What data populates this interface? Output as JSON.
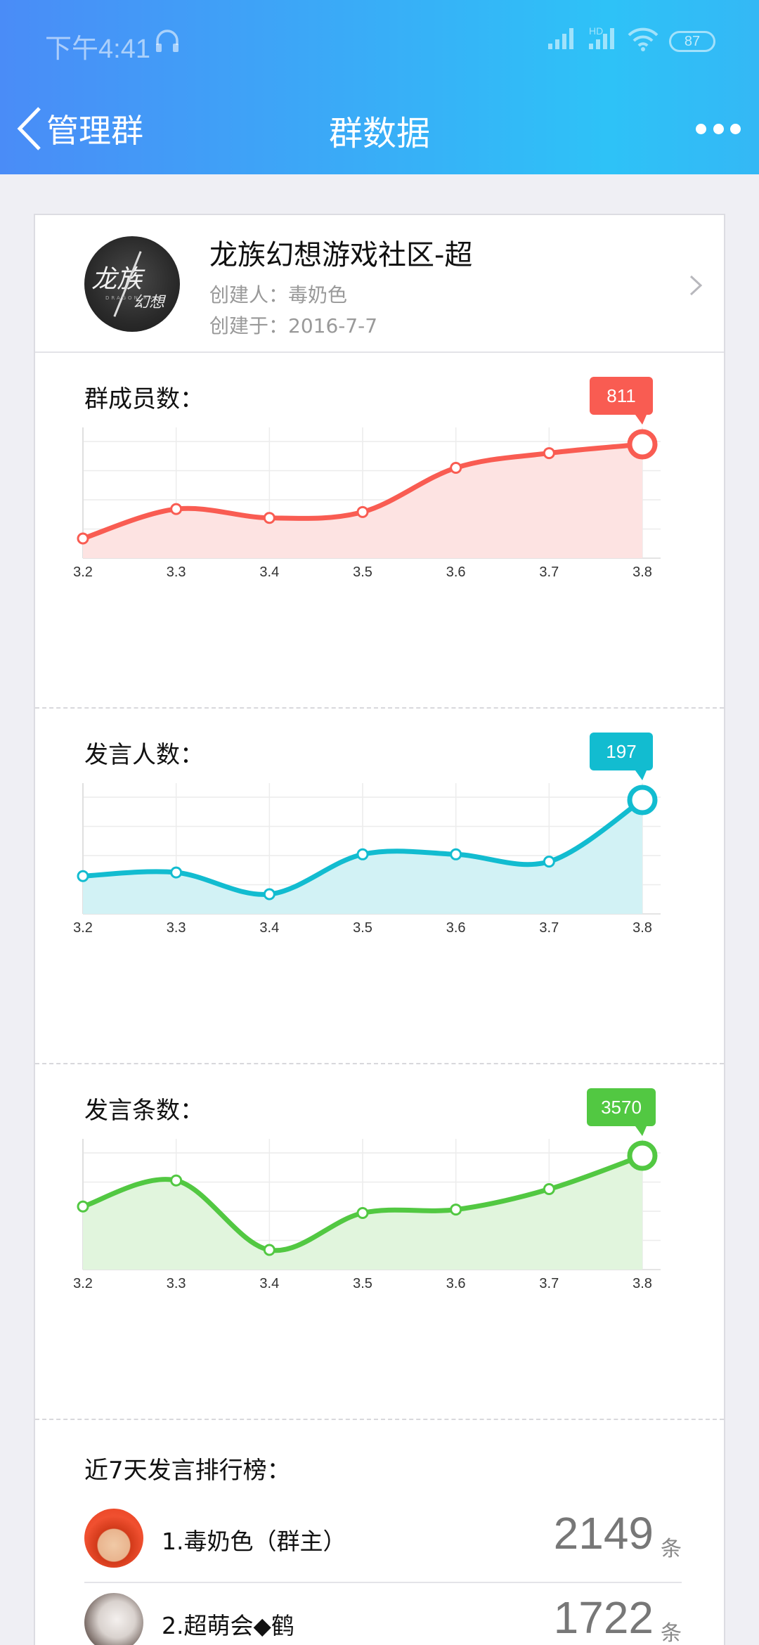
{
  "status_bar": {
    "time": "下午4:41",
    "network_badge": "HD",
    "battery": "87"
  },
  "nav": {
    "back_label": "管理群",
    "title": "群数据",
    "more_icon": "more-icon"
  },
  "group": {
    "name": "龙族幻想游戏社区-超",
    "creator": "创建人：毒奶色",
    "created": "创建于：2016-7-7",
    "avatar_text": "龙族",
    "avatar_text2": "幻想",
    "avatar_sub": "DRAGON RAJA"
  },
  "charts_meta": {
    "members_title": "群成员数：",
    "speakers_title": "发言人数：",
    "messages_title": "发言条数："
  },
  "chart_data": [
    {
      "type": "area",
      "categories": [
        "3.2",
        "3.3",
        "3.4",
        "3.5",
        "3.6",
        "3.7",
        "3.8"
      ],
      "series": [
        {
          "values": [
            795,
            800,
            798.5,
            799.5,
            807,
            809.5,
            811
          ]
        }
      ],
      "highlight_label": "811",
      "color": "#f95c52",
      "fill": "#fde3e2",
      "grid": true
    },
    {
      "type": "area",
      "categories": [
        "3.2",
        "3.3",
        "3.4",
        "3.5",
        "3.6",
        "3.7",
        "3.8"
      ],
      "series": [
        {
          "values": [
            176,
            177,
            171,
            182,
            182,
            180,
            197
          ]
        }
      ],
      "highlight_label": "197",
      "color": "#12bcd0",
      "fill": "#d2f2f5",
      "grid": true
    },
    {
      "type": "area",
      "categories": [
        "3.2",
        "3.3",
        "3.4",
        "3.5",
        "3.6",
        "3.7",
        "3.8"
      ],
      "series": [
        {
          "values": [
            2400,
            3000,
            1400,
            2250,
            2330,
            2800,
            3570
          ]
        }
      ],
      "highlight_label": "3570",
      "color": "#52c842",
      "fill": "#e1f5dd",
      "grid": true
    }
  ],
  "ranking": {
    "title": "近7天发言排行榜：",
    "unit": "条",
    "rows": [
      {
        "name": "1.毒奶色（群主）",
        "value": "2149"
      },
      {
        "name": "2.超萌会◆鹤",
        "value": "1722"
      }
    ]
  }
}
